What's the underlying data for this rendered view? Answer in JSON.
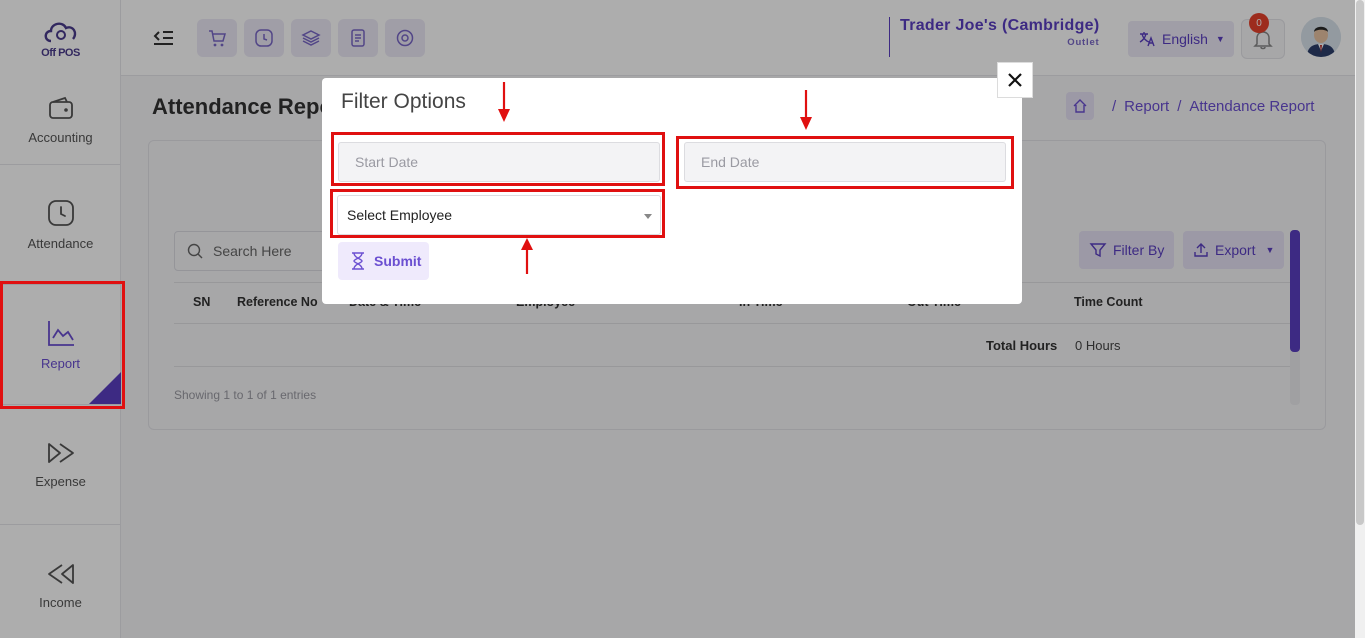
{
  "app": {
    "logo_text": "Off POS"
  },
  "sidebar": {
    "items": [
      {
        "label": "Accounting",
        "icon": "wallet-icon"
      },
      {
        "label": "Attendance",
        "icon": "clock-icon"
      },
      {
        "label": "Report",
        "icon": "chart-icon",
        "active": true
      },
      {
        "label": "Expense",
        "icon": "expense-icon"
      },
      {
        "label": "Income",
        "icon": "income-icon"
      }
    ]
  },
  "topbar": {
    "quick_icons": [
      "cart-icon",
      "clock-icon",
      "layers-icon",
      "receipt-icon",
      "target-icon"
    ],
    "outlet_name": "Trader Joe's (Cambridge)",
    "outlet_sub": "Outlet",
    "language": "English",
    "notification_count": "0"
  },
  "page": {
    "title": "Attendance Report",
    "breadcrumb": [
      "Report",
      "Attendance Report"
    ]
  },
  "table": {
    "search_placeholder": "Search Here",
    "filter_label": "Filter By",
    "export_label": "Export",
    "columns": [
      "SN",
      "Reference No",
      "Date & Time",
      "Employee",
      "In Time",
      "Out Time",
      "Time Count"
    ],
    "total_label": "Total Hours",
    "total_value": "0 Hours",
    "showing": "Showing 1 to 1 of 1 entries"
  },
  "modal": {
    "title": "Filter Options",
    "start_date_placeholder": "Start Date",
    "end_date_placeholder": "End Date",
    "employee_select": "Select Employee",
    "submit_label": "Submit"
  },
  "colors": {
    "accent": "#5a3ec2",
    "annotation": "#e01010",
    "badge": "#e8422c"
  }
}
